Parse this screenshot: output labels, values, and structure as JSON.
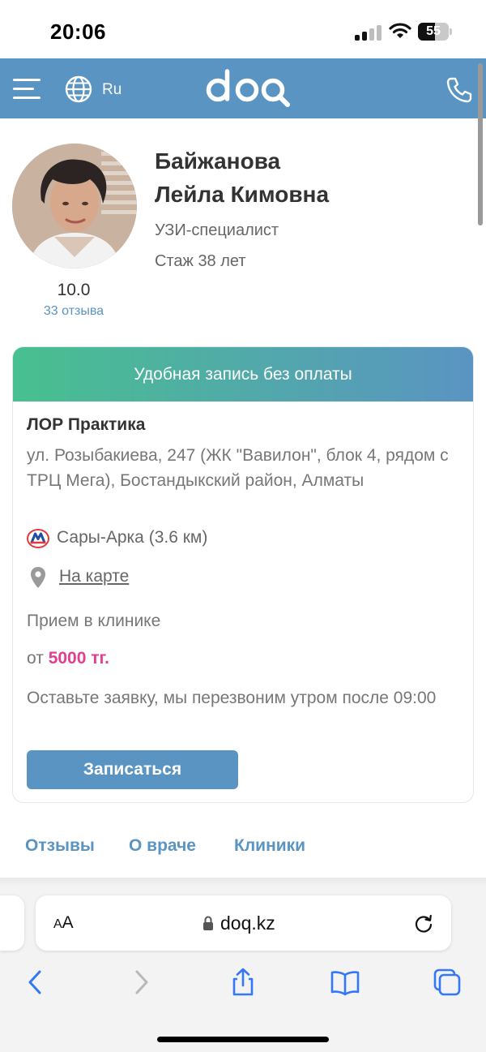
{
  "status_bar": {
    "time": "20:06",
    "battery_level": "55"
  },
  "header": {
    "language": "Ru",
    "logo_text": "doq"
  },
  "doctor": {
    "name_line1": "Байжанова",
    "name_line2": "Лейла Кимовна",
    "specialty": "УЗИ-специалист",
    "experience": "Стаж 38 лет",
    "rating": "10.0",
    "reviews_count": "33 отзыва"
  },
  "booking_card": {
    "banner": "Удобная запись без оплаты",
    "clinic_name": "ЛОР Практика",
    "address": "ул. Розыбакиева, 247 (ЖК \"Вавилон\", блок 4, рядом с ТРЦ Мега), Бостандыкский район, Алматы",
    "metro": "Сары-Арка (3.6 км)",
    "map_link": "На карте",
    "reception_type": "Прием в клинике",
    "price_prefix": "от",
    "price": "5000 тг.",
    "callback_note": "Оставьте заявку, мы перезвоним утром после 09:00",
    "book_button": "Записаться"
  },
  "tabs": [
    "Отзывы",
    "О враче",
    "Клиники"
  ],
  "browser": {
    "aa_small": "A",
    "aa_big": "A",
    "url": "doq.kz"
  },
  "colors": {
    "brand_blue": "#5a94c2",
    "banner_green": "#48c08f",
    "price_pink": "#e33e8f"
  }
}
